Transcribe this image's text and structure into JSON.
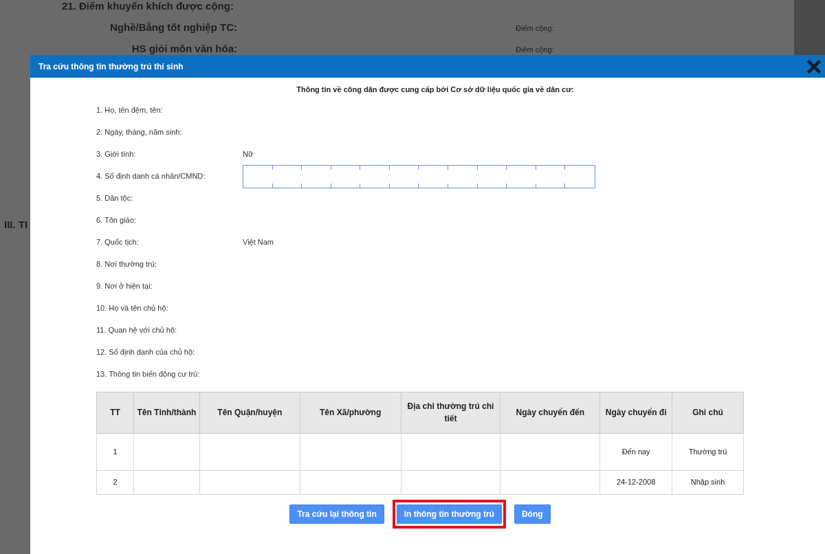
{
  "background": {
    "lines": [
      {
        "kind": "section",
        "label": "21. Điểm khuyến khích được cộng:"
      },
      {
        "kind": "pair",
        "label": "Nghề/Bằng tốt nghiệp TC:",
        "extra": "Điểm cộng:"
      },
      {
        "kind": "pair",
        "label": "HS giỏi môn văn hóa:",
        "extra": "Điểm cộng:"
      }
    ],
    "side_heading": "III. TI"
  },
  "dialog": {
    "title": "Tra cứu thông tin thường trú thí sinh",
    "heading": "Thông tin về công dân được cung cấp bởi Cơ sở dữ liệu quốc gia về dân cư:",
    "fields": [
      {
        "kind": "text",
        "label": "1. Họ, tên đệm, tên:"
      },
      {
        "kind": "text",
        "label": "2. Ngày, tháng, năm sinh:"
      },
      {
        "kind": "text",
        "label": "3. Giới tính:",
        "value": "Nữ"
      },
      {
        "kind": "id_box",
        "label": "4. Số định danh cá nhân/CMND:"
      },
      {
        "kind": "text",
        "label": "5. Dân tộc:"
      },
      {
        "kind": "text",
        "label": "6. Tôn giáo:"
      },
      {
        "kind": "text",
        "label": "7. Quốc tịch:",
        "value": "Việt Nam"
      },
      {
        "kind": "text",
        "label": "8. Nơi thường trú:"
      },
      {
        "kind": "text",
        "label": "9. Nơi ở hiện tại:"
      },
      {
        "kind": "text",
        "label": "10. Họ và tên chủ hộ:"
      },
      {
        "kind": "text",
        "label": "11. Quan hệ với chủ hộ:"
      },
      {
        "kind": "text",
        "label": "12. Số định danh của chủ hộ:"
      },
      {
        "kind": "text",
        "label": "13. Thông tin biến động cư trú:"
      }
    ],
    "table": {
      "columns": [
        "TT",
        "Tên Tỉnh/thành",
        "Tên Quận/huyện",
        "Tên Xã/phường",
        "Địa chỉ thường trú chi tiết",
        "Ngày chuyển đến",
        "Ngày chuyển đi",
        "Ghi chú"
      ],
      "rows": [
        [
          "1",
          "",
          "",
          "",
          "",
          "",
          "Đến nay",
          "Thường trú"
        ],
        [
          "2",
          "",
          "",
          "",
          "",
          "",
          "24-12-2008",
          "Nhập sinh"
        ]
      ]
    },
    "buttons": [
      {
        "label": "Tra cứu lại thông tin",
        "highlighted": false
      },
      {
        "label": "In thông tin thường trú",
        "highlighted": true
      },
      {
        "label": "Đóng",
        "highlighted": false
      }
    ]
  }
}
